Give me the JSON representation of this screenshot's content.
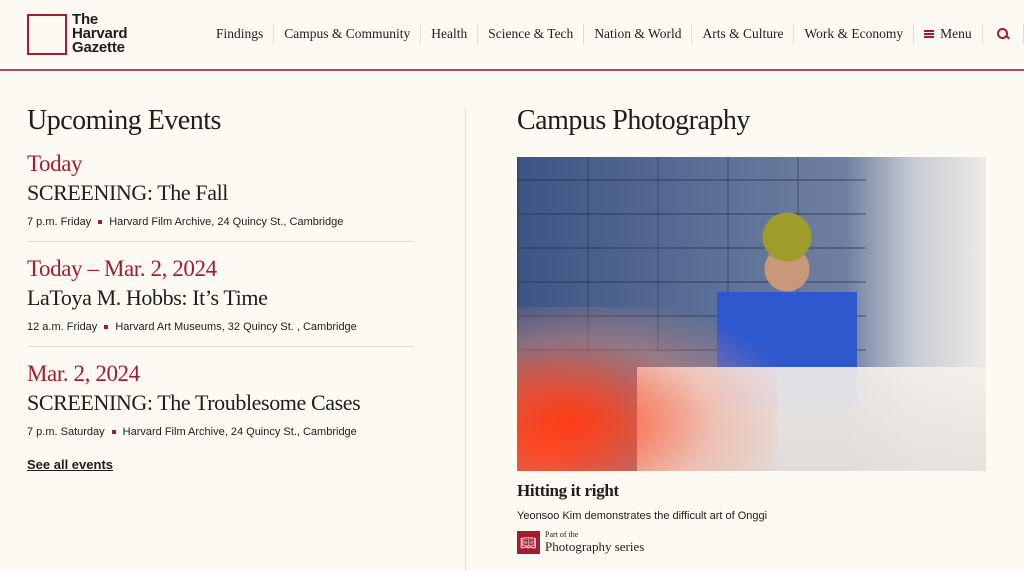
{
  "header": {
    "logo": [
      "The",
      "Harvard",
      "Gazette"
    ],
    "nav": [
      "Findings",
      "Campus & Community",
      "Health",
      "Science & Tech",
      "Nation & World",
      "Arts & Culture",
      "Work & Economy"
    ],
    "menu_label": "Menu"
  },
  "events": {
    "heading": "Upcoming Events",
    "items": [
      {
        "date": "Today",
        "title": "SCREENING: The Fall",
        "time": "7 p.m. Friday",
        "location": "Harvard Film Archive, 24 Quincy St., Cambridge"
      },
      {
        "date": "Today – Mar. 2, 2024",
        "title": "LaToya M. Hobbs: It’s Time",
        "time": "12 a.m. Friday",
        "location": "Harvard Art Museums, 32 Quincy St. , Cambridge"
      },
      {
        "date": "Mar. 2, 2024",
        "title": "SCREENING: The Troublesome Cases",
        "time": "7 p.m. Saturday",
        "location": "Harvard Film Archive, 24 Quincy St., Cambridge"
      }
    ],
    "see_all": "See all events"
  },
  "photography": {
    "heading": "Campus Photography",
    "caption_title": "Hitting it right",
    "caption": "Yeonsoo Kim demonstrates the difficult art of Onggi",
    "series_prefix": "Part of the",
    "series_name": "Photography series"
  },
  "colors": {
    "accent": "#a51c30",
    "background": "#fdf9f3"
  }
}
